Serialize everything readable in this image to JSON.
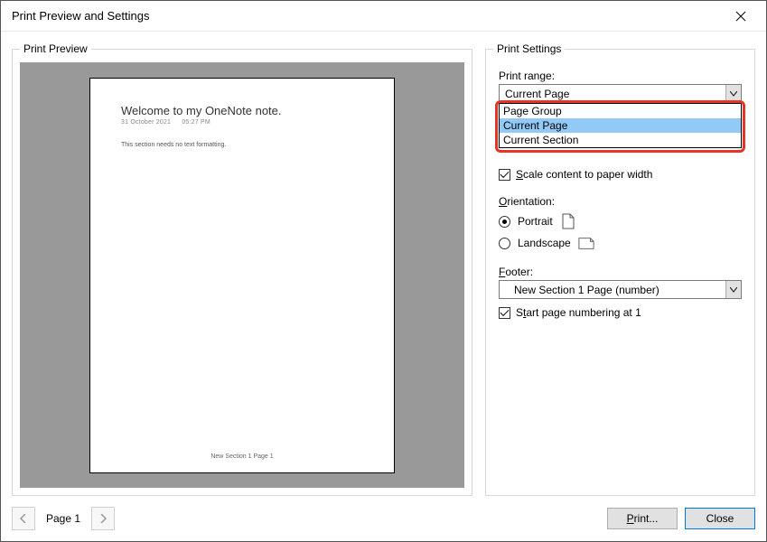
{
  "window": {
    "title": "Print Preview and Settings"
  },
  "preview": {
    "legend": "Print Preview",
    "page_title": "Welcome to my OneNote note.",
    "page_date": "31 October 2021",
    "page_time": "05:27 PM",
    "page_body": "This section needs no text formatting.",
    "page_footer": "New Section 1 Page 1"
  },
  "settings": {
    "legend": "Print Settings",
    "print_range_label": "Print range:",
    "print_range_value": "Current Page",
    "print_range_options": [
      "Page Group",
      "Current Page",
      "Current Section"
    ],
    "scale_label": "Scale content to paper width",
    "scale_checked": true,
    "orientation_label": "Orientation:",
    "orientation_value": "Portrait",
    "portrait_label": "Portrait",
    "landscape_label": "Landscape",
    "footer_label": "Footer:",
    "footer_value": "New Section 1 Page (number)",
    "start_numbering_label": "Start page numbering at 1",
    "start_numbering_checked": true
  },
  "bottom": {
    "page_indicator": "Page 1",
    "print_btn": "Print...",
    "close_btn": "Close"
  }
}
